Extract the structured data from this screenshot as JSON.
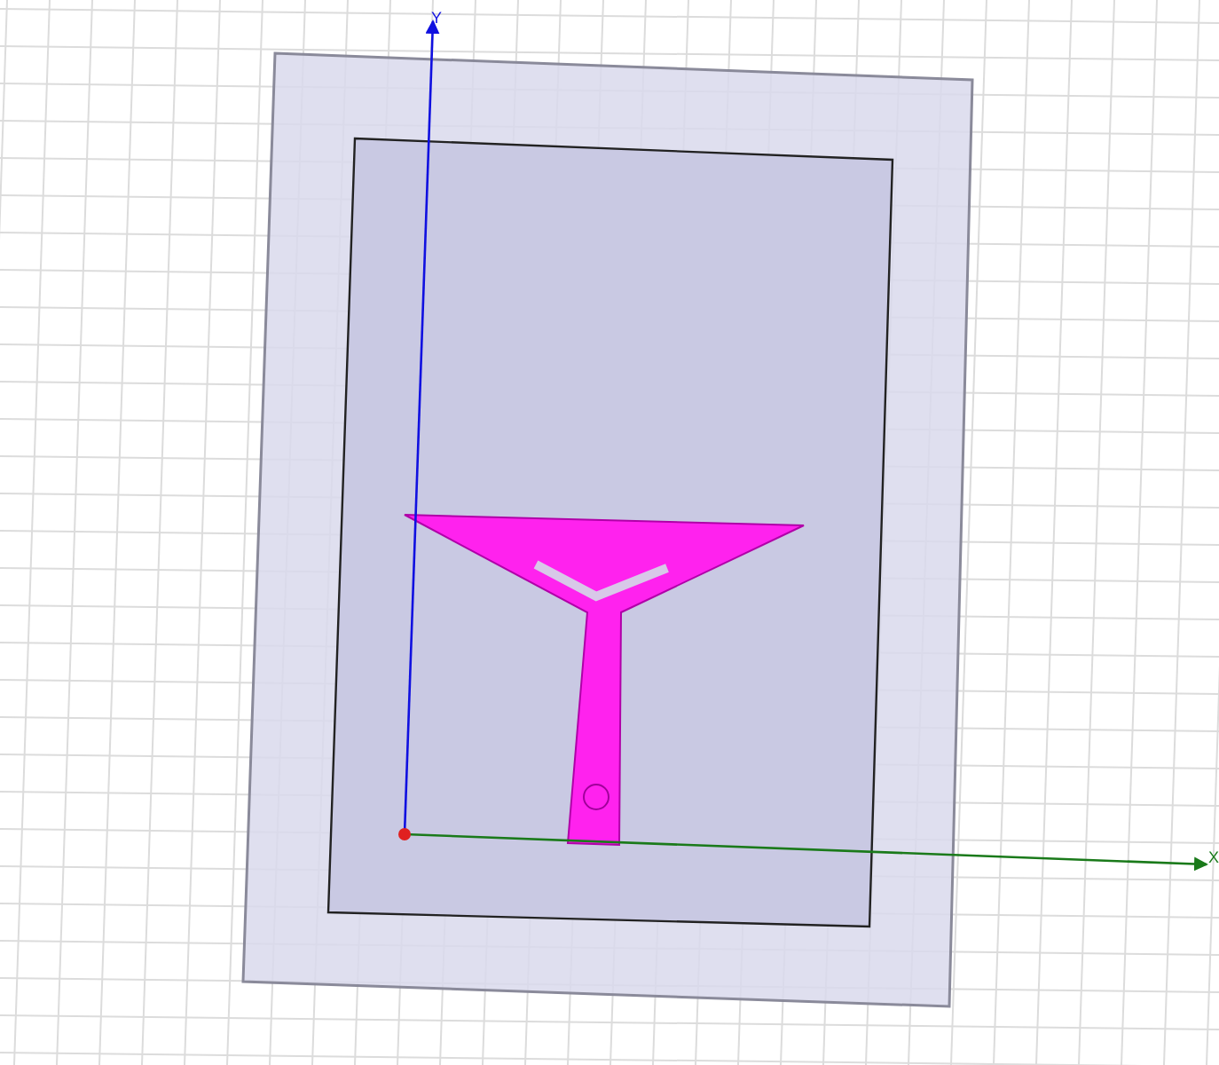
{
  "viewport": {
    "axes": [
      {
        "kind": "y",
        "label": "Y"
      },
      {
        "kind": "x",
        "label": "X"
      }
    ]
  }
}
